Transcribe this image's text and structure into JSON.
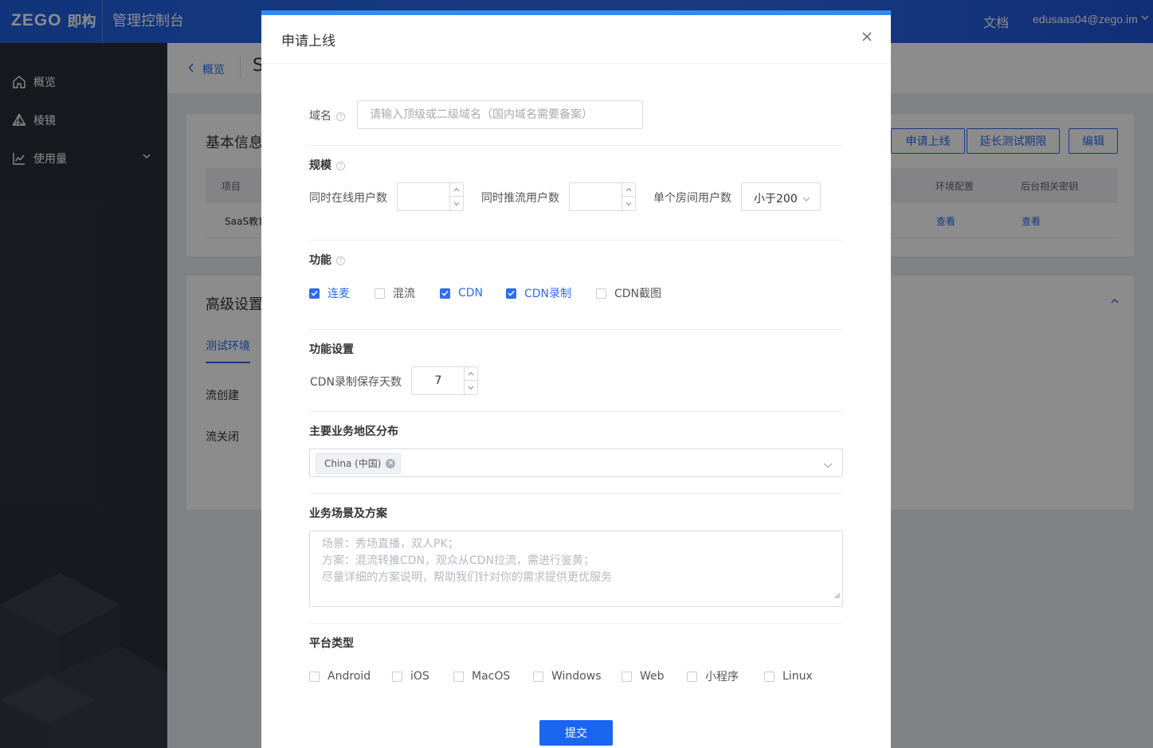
{
  "header": {
    "logo_text": "ZEGO",
    "logo_cn": "即构",
    "console_title": "管理控制台",
    "docs": "文档",
    "user_email": "edusaas04@zego.im"
  },
  "sidebar": {
    "items": [
      {
        "label": "概览",
        "icon": "home-icon"
      },
      {
        "label": "棱镜",
        "icon": "prism-icon"
      },
      {
        "label": "使用量",
        "icon": "chart-icon"
      }
    ]
  },
  "page": {
    "back_label": "概览",
    "title_partial": "S",
    "basic_info": {
      "title": "基本信息",
      "buttons": {
        "apply_online": "申请上线",
        "extend_test": "延长测试期限",
        "edit": "编辑"
      },
      "table_headers": {
        "item": "项目",
        "env_config": "环境配置",
        "backend_key": "后台相关密钥"
      },
      "row": {
        "item": "SaaS教育",
        "env_link": "查看",
        "key_link": "查看"
      }
    },
    "advanced": {
      "title": "高级设置",
      "tab": "测试环境",
      "labels": [
        "流创建",
        "流关闭"
      ]
    }
  },
  "modal": {
    "title": "申请上线",
    "domain": {
      "label": "域名",
      "placeholder": "请输入顶级或二级域名（国内域名需要备案）"
    },
    "scale": {
      "title": "规模",
      "online_users_label": "同时在线用户数",
      "online_users_value": "",
      "push_users_label": "同时推流用户数",
      "push_users_value": "",
      "room_users_label": "单个房间用户数",
      "room_users_value": "小于200"
    },
    "features": {
      "title": "功能",
      "options": [
        {
          "label": "连麦",
          "checked": true
        },
        {
          "label": "混流",
          "checked": false
        },
        {
          "label": "CDN",
          "checked": true
        },
        {
          "label": "CDN录制",
          "checked": true
        },
        {
          "label": "CDN截图",
          "checked": false
        }
      ]
    },
    "feature_settings": {
      "title": "功能设置",
      "cdn_days_label": "CDN录制保存天数",
      "cdn_days_value": "7"
    },
    "region": {
      "title": "主要业务地区分布",
      "tag": "China (中国)"
    },
    "scenario": {
      "title": "业务场景及方案",
      "placeholder_lines": [
        "场景：秀场直播，双人PK；",
        "方案：混流转推CDN，观众从CDN拉流，需进行鉴黄；",
        "尽量详细的方案说明，帮助我们针对你的需求提供更优服务"
      ]
    },
    "platform": {
      "title": "平台类型",
      "options": [
        "Android",
        "iOS",
        "MacOS",
        "Windows",
        "Web",
        "小程序",
        "Linux"
      ]
    },
    "submit": "提交"
  },
  "colors": {
    "primary": "#2f6cf0",
    "sidebar": "#2b2f3a",
    "header": "#2d6cf0"
  }
}
